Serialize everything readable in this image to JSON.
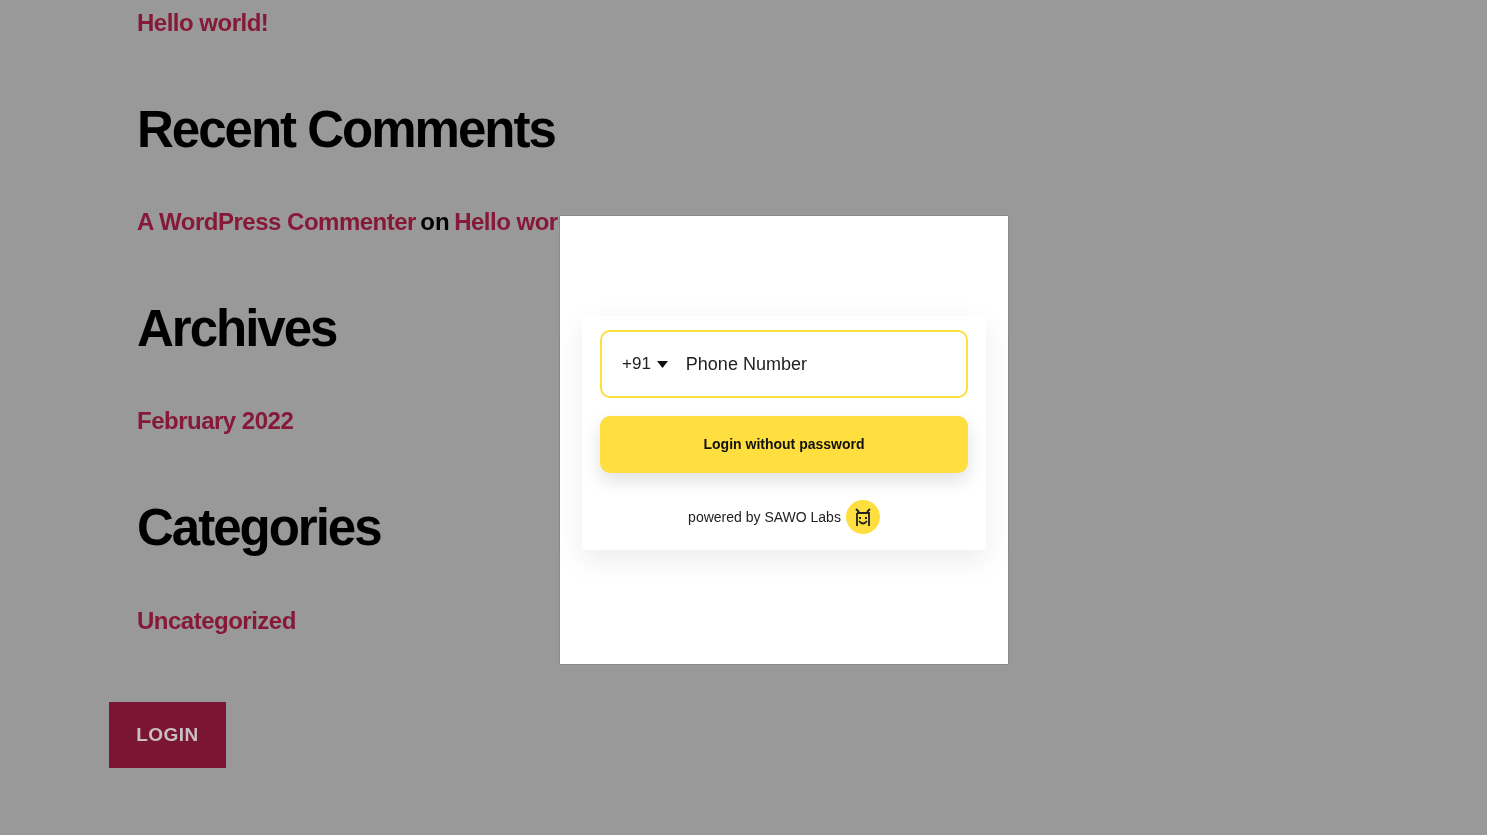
{
  "recent_post": "Hello world!",
  "sections": [
    {
      "heading": "Recent Comments",
      "kind": "comment",
      "author": "A WordPress Commenter",
      "joiner": "on",
      "post": "Hello wor"
    },
    {
      "heading": "Archives",
      "kind": "link",
      "link": "February 2022"
    },
    {
      "heading": "Categories",
      "kind": "link",
      "link": "Uncategorized"
    }
  ],
  "login_button": "LOGIN",
  "modal": {
    "country_code": "+91",
    "phone_placeholder": "Phone Number",
    "submit": "Login without password",
    "powered_by": "powered by SAWO Labs"
  }
}
